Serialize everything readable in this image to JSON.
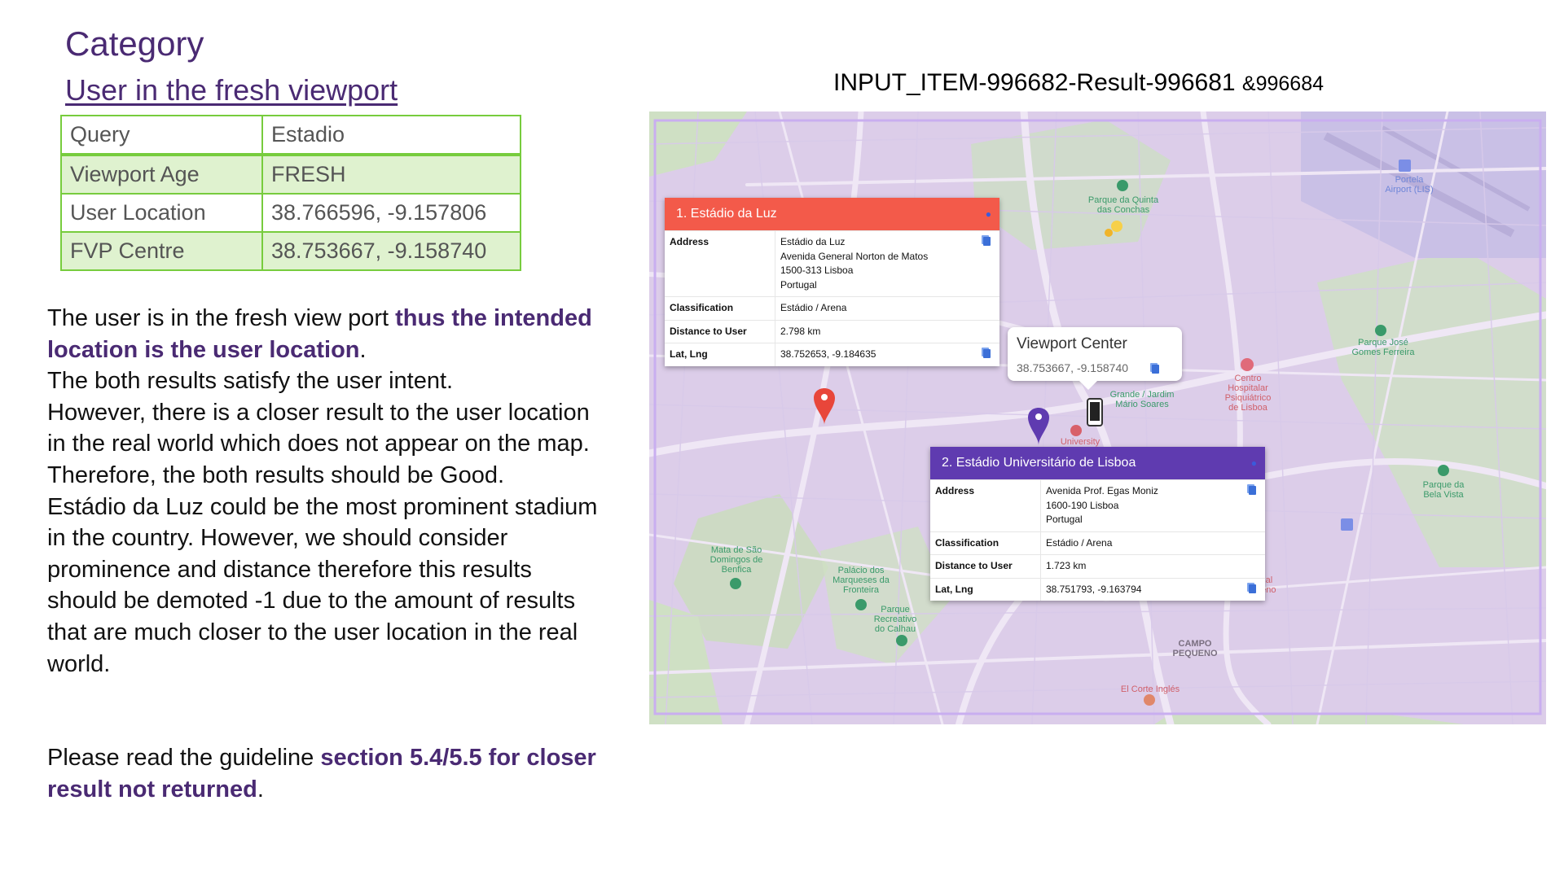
{
  "category": "Category",
  "subtitle": "User in the fresh viewport",
  "info_table": [
    {
      "key": "Query",
      "value": "Estadio"
    },
    {
      "key": "Viewport Age",
      "value": "FRESH"
    },
    {
      "key": "User Location",
      "value": "38.766596, -9.157806"
    },
    {
      "key": "FVP Centre",
      "value": "38.753667, -9.158740"
    }
  ],
  "explanation": {
    "p1_plain": "The user is in the fresh view port ",
    "p1_bold": "thus the intended location is the user location",
    "p1_end": ".",
    "p2": "The both results satisfy the user intent.",
    "p3": "However, there is a closer result to the user location in the real world which does not appear on the map. Therefore, the both results should be Good.",
    "p4": "Estádio da Luz could be the most prominent stadium in the country. However, we should consider prominence and distance therefore this results should be demoted -1 due to the amount of results that are much closer to the user location in the real world.",
    "p5_plain": "Please read the guideline ",
    "p5_bold": "section 5.4/5.5 for closer result not returned",
    "p5_end": "."
  },
  "map_header": {
    "main": "INPUT_ITEM-996682-Result-996681 ",
    "extra": "&996684"
  },
  "colors": {
    "accent_purple": "#4a2a73",
    "table_border": "#77cc3d",
    "table_highlight": "#dff2cf",
    "result1_header": "#f35a4a",
    "result2_header": "#5f3bb0"
  },
  "map": {
    "places": {
      "airport": "Portela\nAirport (LIS)",
      "quinta": "Parque da Quinta\ndas Conchas",
      "jose": "Parque José\nGomes Ferreira",
      "hospital": "Centro\nHospitalar\nPsiquiátrico\nde Lisboa",
      "campo_grande": "Grande / Jardim\nMário Soares",
      "university": "University",
      "bela_vista": "Parque da\nBela Vista",
      "mata": "Mata de São\nDomingos de\nBenfica",
      "palacio": "Palácio dos\nMarqueses da\nFronteira",
      "calhau": "Parque\nRecreativo\ndo Calhau",
      "campo_pequeno": "CAMPO\nPEQUENO",
      "corte_ingles": "El Corte Inglés",
      "comercial": "rcial\nueno"
    },
    "result1": {
      "title": "1. Estádio da Luz",
      "rows": [
        {
          "k": "Address",
          "v": "Estádio da Luz\nAvenida General Norton de Matos\n1500-313 Lisboa\nPortugal",
          "copy": true
        },
        {
          "k": "Classification",
          "v": "Estádio / Arena",
          "copy": false
        },
        {
          "k": "Distance to User",
          "v": "2.798 km",
          "copy": false
        },
        {
          "k": "Lat, Lng",
          "v": "38.752653, -9.184635",
          "copy": true
        }
      ]
    },
    "result2": {
      "title": "2. Estádio Universitário de Lisboa",
      "rows": [
        {
          "k": "Address",
          "v": "Avenida Prof. Egas Moniz\n1600-190 Lisboa\nPortugal",
          "copy": true
        },
        {
          "k": "Classification",
          "v": "Estádio / Arena",
          "copy": false
        },
        {
          "k": "Distance to User",
          "v": "1.723 km",
          "copy": false
        },
        {
          "k": "Lat, Lng",
          "v": "38.751793, -9.163794",
          "copy": true
        }
      ]
    },
    "viewport_center": {
      "title": "Viewport Center",
      "coords": "38.753667, -9.158740"
    }
  }
}
